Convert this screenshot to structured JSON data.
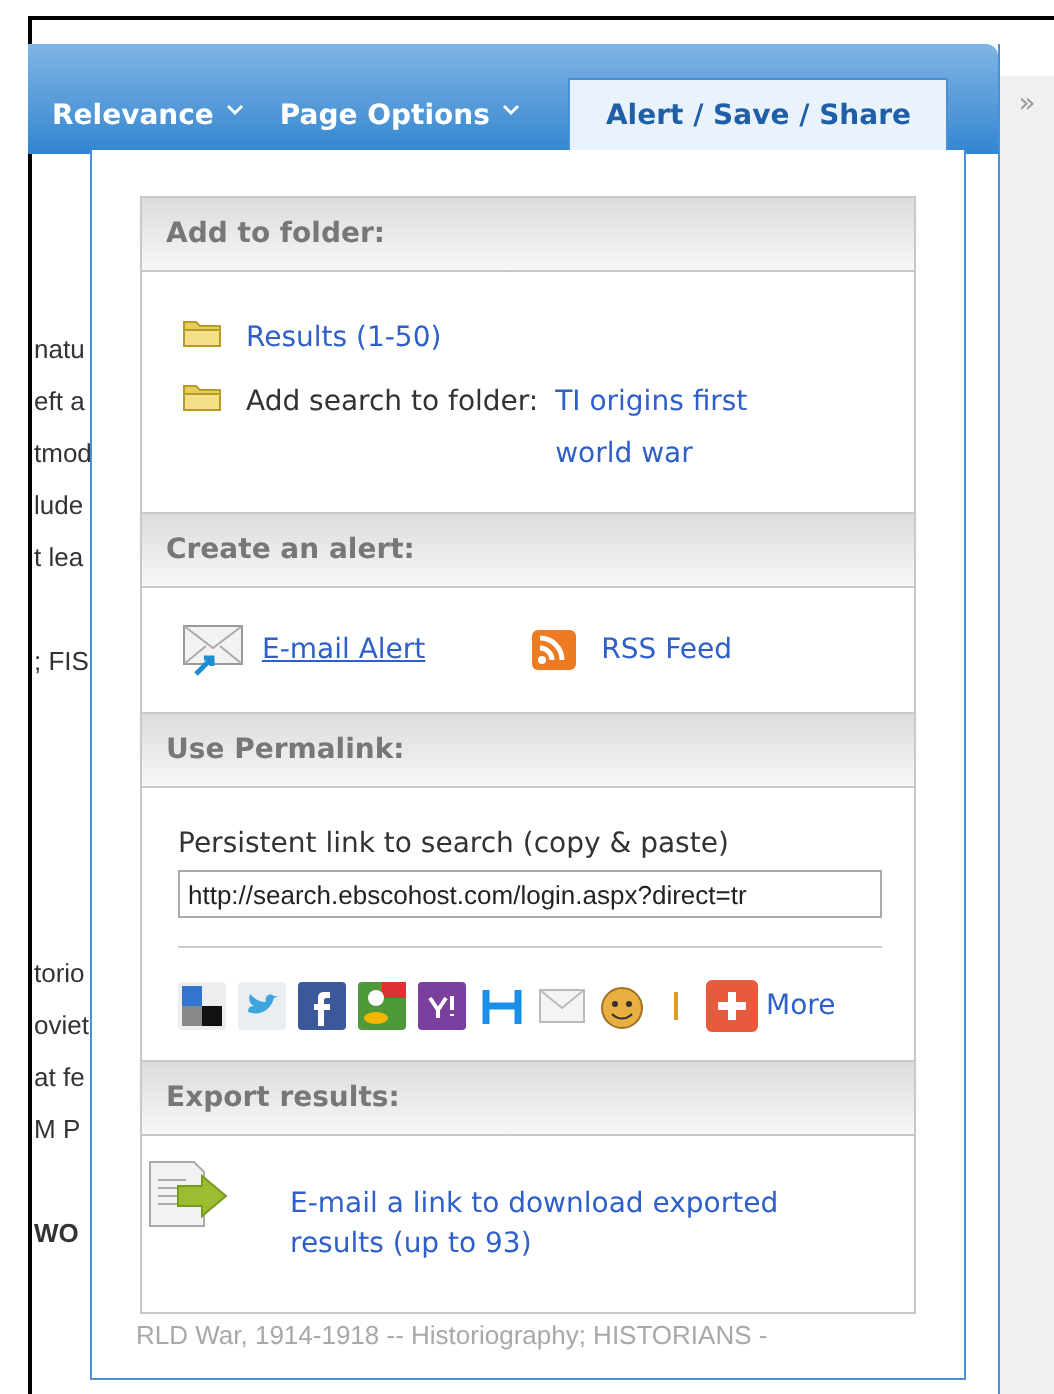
{
  "tabs": [
    {
      "label": "Relevance",
      "selected": false
    },
    {
      "label": "Page Options",
      "selected": false
    },
    {
      "label": "Alert / Save / Share",
      "selected": true
    }
  ],
  "collapse_button": "»",
  "background_text": [
    [
      "natu",
      "eft a",
      "tmod",
      "lude",
      "t lea"
    ],
    [
      "; FIS"
    ],
    [
      "torio",
      "oviet",
      "at fe",
      "M P"
    ],
    [
      "WO"
    ]
  ],
  "background_bottom_text": "RLD War, 1914-1918 -- Historiography; HISTORIANS -",
  "sections": [
    {
      "kind": "folder",
      "title": "Add to folder:",
      "items": [
        {
          "link": "Results (1-50)"
        },
        {
          "text": "Add search to folder: ",
          "link": "TI origins first world war"
        }
      ]
    },
    {
      "kind": "alert",
      "title": "Create an alert:",
      "email_link": "E-mail Alert",
      "rss_link": "RSS Feed"
    },
    {
      "kind": "permalink",
      "title": "Use Permalink:",
      "label": "Persistent link to search (copy & paste)",
      "value": "http://search.ebscohost.com/login.aspx?direct=tr",
      "more": "More"
    },
    {
      "kind": "export",
      "title": "Export results:",
      "link": "E-mail a link to download exported results (up to 93)"
    }
  ]
}
